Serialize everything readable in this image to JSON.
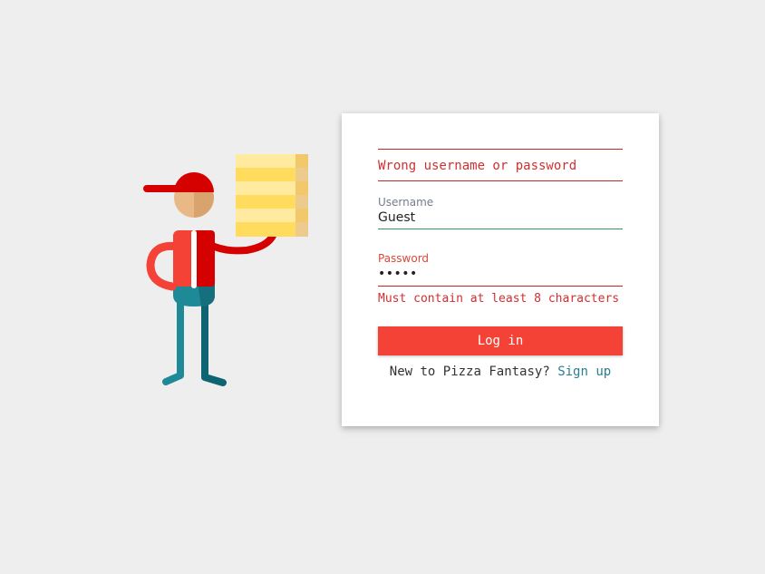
{
  "illustration": {
    "name": "pizza-delivery-person",
    "colors": {
      "cap": "#d50000",
      "skin": "#e8b887",
      "shirt": "#f44336",
      "pants": "#1e8a98",
      "box": "#ffe082"
    }
  },
  "login": {
    "error_message": "Wrong username or password",
    "username_label": "Username",
    "username_value": "Guest",
    "password_label": "Password",
    "password_value": "•••••",
    "password_hint": "Must contain at least 8 characters",
    "login_button": "Log in",
    "signup_prompt": "New to Pizza Fantasy?",
    "signup_link": "Sign up"
  },
  "colors": {
    "accent": "#f44336",
    "error": "#d32f2f",
    "valid": "#2e9c5a",
    "link": "#2a7f91",
    "background": "#eeeeee"
  }
}
